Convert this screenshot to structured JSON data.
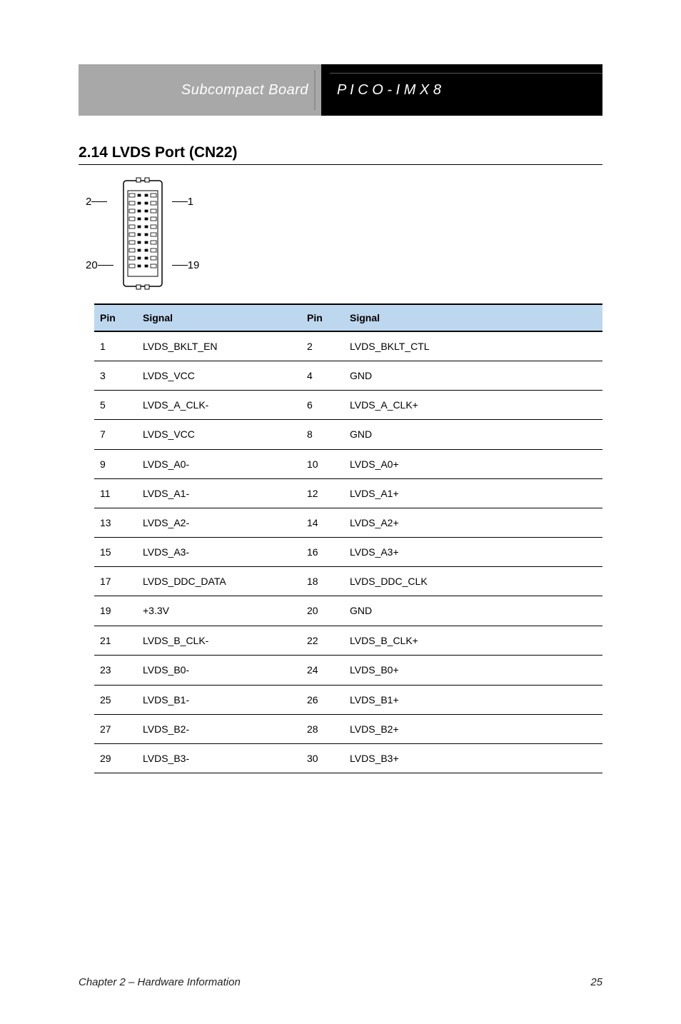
{
  "header": {
    "left": "Subcompact Board",
    "right": "P I C O - I M X 8"
  },
  "connector": {
    "title": "2.14 LVDS Port (CN22)",
    "pin_top_left": "2",
    "pin_top_right": "1",
    "pin_bottom_left": "20",
    "pin_bottom_right": "19"
  },
  "table": {
    "headers": {
      "pin": "Pin",
      "signal": "Signal"
    },
    "rows": [
      {
        "pin": "1",
        "signal": "LVDS_BKLT_EN",
        "pin2": "2",
        "signal2": "LVDS_BKLT_CTL"
      },
      {
        "pin": "3",
        "signal": "LVDS_VCC",
        "pin2": "4",
        "signal2": "GND"
      },
      {
        "pin": "5",
        "signal": "LVDS_A_CLK-",
        "pin2": "6",
        "signal2": "LVDS_A_CLK+"
      },
      {
        "pin": "7",
        "signal": "LVDS_VCC",
        "pin2": "8",
        "signal2": "GND",
        "group_end": true
      },
      {
        "pin": "9",
        "signal": "LVDS_A0-",
        "pin2": "10",
        "signal2": "LVDS_A0+"
      },
      {
        "pin": "11",
        "signal": "LVDS_A1-",
        "pin2": "12",
        "signal2": "LVDS_A1+"
      },
      {
        "pin": "13",
        "signal": "LVDS_A2-",
        "pin2": "14",
        "signal2": "LVDS_A2+"
      },
      {
        "pin": "15",
        "signal": "LVDS_A3-",
        "pin2": "16",
        "signal2": "LVDS_A3+"
      },
      {
        "pin": "17",
        "signal": "LVDS_DDC_DATA",
        "pin2": "18",
        "signal2": "LVDS_DDC_CLK"
      },
      {
        "pin": "19",
        "signal": "+3.3V",
        "pin2": "20",
        "signal2": "GND",
        "group_end": true
      },
      {
        "pin": "21",
        "signal": "LVDS_B_CLK-",
        "pin2": "22",
        "signal2": "LVDS_B_CLK+"
      },
      {
        "pin": "23",
        "signal": "LVDS_B0-",
        "pin2": "24",
        "signal2": "LVDS_B0+",
        "group_end": true
      },
      {
        "pin": "25",
        "signal": "LVDS_B1-",
        "pin2": "26",
        "signal2": "LVDS_B1+"
      },
      {
        "pin": "27",
        "signal": "LVDS_B2-",
        "pin2": "28",
        "signal2": "LVDS_B2+"
      },
      {
        "pin": "29",
        "signal": "LVDS_B3-",
        "pin2": "30",
        "signal2": "LVDS_B3+"
      }
    ]
  },
  "footer": {
    "left": "Chapter 2 – Hardware Information",
    "right": "25"
  }
}
